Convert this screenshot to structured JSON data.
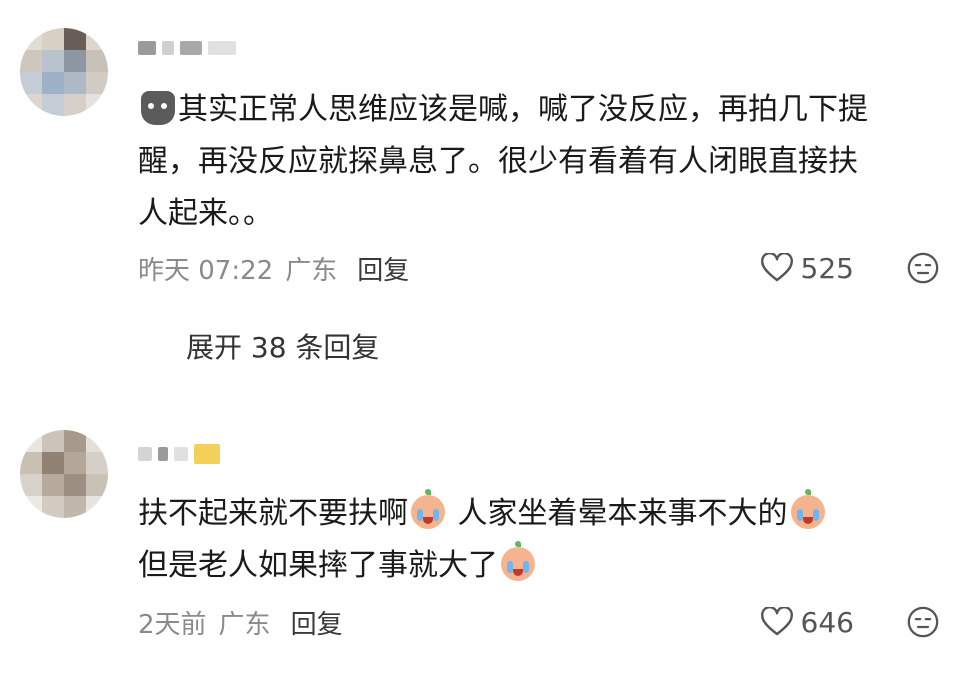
{
  "comments": [
    {
      "username_redacted": true,
      "emoji_prefix": "cat-emoji",
      "lines": [
        "其实正常人思维应该是喊，喊了没反应，再拍几下提",
        "醒，再没反应就探鼻息了。很少有看着有人闭眼直接扶",
        "人起来。。"
      ],
      "time": "昨天 07:22",
      "location": "广东",
      "reply_label": "回复",
      "likes": "525",
      "expand_label": "展开 38 条回复"
    },
    {
      "username_redacted": true,
      "segments": [
        "扶不起来就不要扶啊",
        " 人家坐着晕本来事不大的",
        "但是老人如果摔了事就大了"
      ],
      "emoji": "crying-face-emoji",
      "time": "2天前",
      "location": "广东",
      "reply_label": "回复",
      "likes": "646"
    }
  ],
  "colors": {
    "text": "#1a1a1a",
    "meta": "#8a8a8a",
    "reply": "#3a3a3a"
  },
  "icons": [
    "heart-icon",
    "dislike-face-icon"
  ]
}
